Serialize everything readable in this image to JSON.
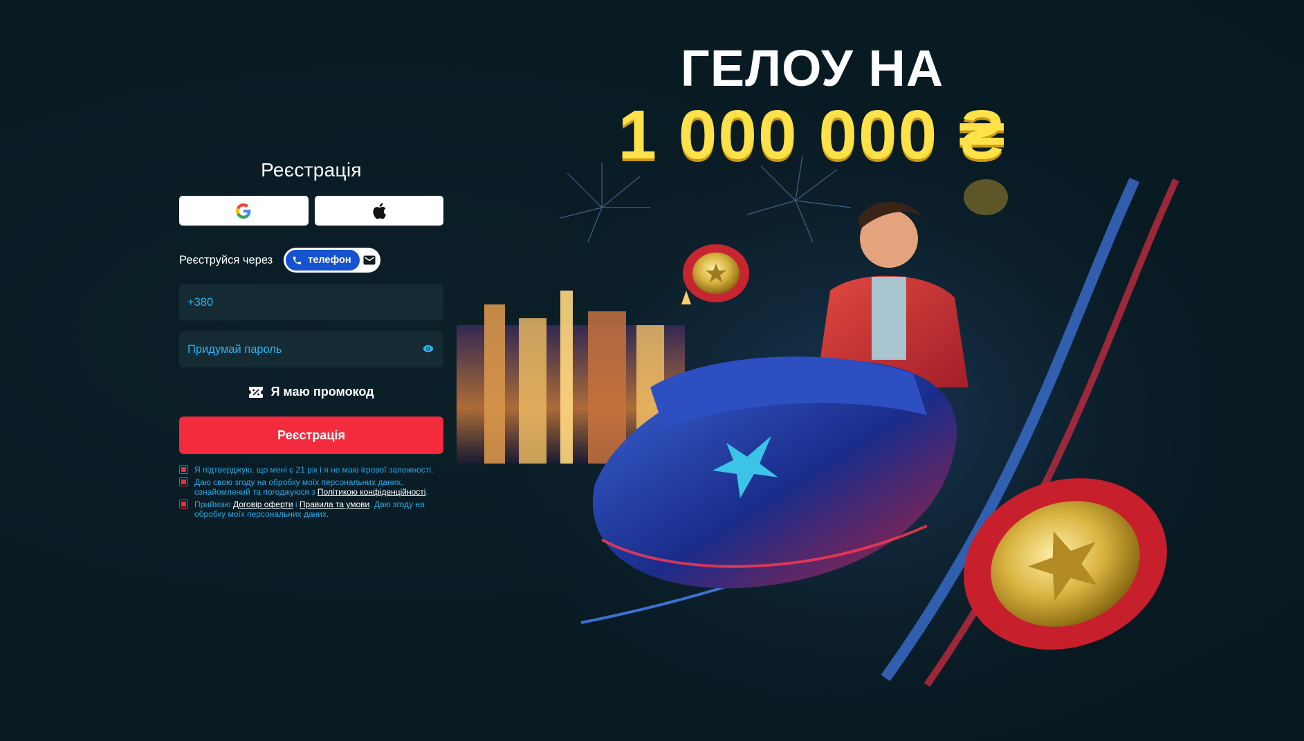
{
  "form": {
    "title": "Реєстрація",
    "social": [
      {
        "name": "google",
        "icon": "google-icon"
      },
      {
        "name": "apple",
        "icon": "apple-icon"
      }
    ],
    "register_via_label": "Реєструйся через",
    "method_switch": {
      "selected": "телефон",
      "options": [
        "phone",
        "email"
      ],
      "phone_icon": "phone-icon",
      "email_icon": "envelope-icon"
    },
    "phone_input": {
      "value": "",
      "placeholder": "+380"
    },
    "password_input": {
      "value": "",
      "placeholder": "Придумай пароль",
      "toggle_icon": "eye-icon"
    },
    "promo_label": "Я маю промокод",
    "promo_icon": "percent-ticket-icon",
    "submit_label": "Реєстрація",
    "consents": [
      {
        "text": "Я підтверджую, що мені є 21 рік і я не маю ігрової залежності.",
        "checked": true
      },
      {
        "text_before": "Даю свою згоду на обробку моїх персональних даних, ознайомлений та погоджуюся з ",
        "link": "Політикою конфіденційності",
        "text_after": ".",
        "checked": true
      },
      {
        "text_before": "Приймаю ",
        "link1": "Договір оферти",
        "middle": " і ",
        "link2": "Правила та умови",
        "text_after": ". Даю згоду на обробку моїх персональних даних.",
        "checked": true
      }
    ]
  },
  "banner": {
    "title": "ГЕЛОУ НА",
    "amount": "1 000 000 ₴"
  },
  "colors": {
    "background": "#081a22",
    "field_bg": "#152b34",
    "accent_red": "#f42a3d",
    "accent_blue": "#1553d0",
    "link_blue": "#27a9e6",
    "gold": "#ffe14a"
  }
}
